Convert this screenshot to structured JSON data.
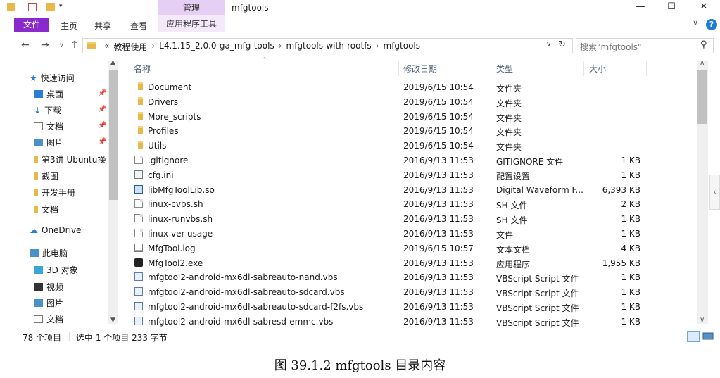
{
  "titlebar": {
    "manage_tab": "管理",
    "title": "mfgtools",
    "minimize": "—",
    "maximize": "☐",
    "close": "✕"
  },
  "ribbon": {
    "file": "文件",
    "home": "主页",
    "share": "共享",
    "view": "查看",
    "app_tools": "应用程序工具"
  },
  "address": {
    "prefix": "«",
    "crumbs": [
      "教程使用",
      "L4.1.15_2.0.0-ga_mfg-tools",
      "mfgtools-with-rootfs",
      "mfgtools"
    ],
    "search_placeholder": "搜索\"mfgtools\""
  },
  "sidebar": {
    "quick_access": "快速访问",
    "items": [
      {
        "label": "桌面",
        "icon": "desktop-icon",
        "pinned": true
      },
      {
        "label": "下载",
        "icon": "download-icon",
        "pinned": true
      },
      {
        "label": "文档",
        "icon": "documents-icon",
        "pinned": true
      },
      {
        "label": "图片",
        "icon": "pictures-icon",
        "pinned": true
      },
      {
        "label": "第3讲 Ubuntu操",
        "icon": "folder-icon",
        "pinned": false
      },
      {
        "label": "截图",
        "icon": "folder-icon",
        "pinned": false
      },
      {
        "label": "开发手册",
        "icon": "folder-icon",
        "pinned": false
      },
      {
        "label": "文档",
        "icon": "folder-icon",
        "pinned": false
      }
    ],
    "onedrive": "OneDrive",
    "this_pc": "此电脑",
    "pc_items": [
      {
        "label": "3D 对象",
        "icon": "3d-objects-icon"
      },
      {
        "label": "视频",
        "icon": "videos-icon"
      },
      {
        "label": "图片",
        "icon": "pictures-icon"
      },
      {
        "label": "文档",
        "icon": "documents-icon"
      }
    ]
  },
  "columns": {
    "name": "名称",
    "date": "修改日期",
    "type": "类型",
    "size": "大小"
  },
  "files": [
    {
      "name": "Document",
      "date": "2019/6/15 10:54",
      "type": "文件夹",
      "size": "",
      "icon": "folder"
    },
    {
      "name": "Drivers",
      "date": "2019/6/15 10:54",
      "type": "文件夹",
      "size": "",
      "icon": "folder"
    },
    {
      "name": "More_scripts",
      "date": "2019/6/15 10:54",
      "type": "文件夹",
      "size": "",
      "icon": "folder"
    },
    {
      "name": "Profiles",
      "date": "2019/6/15 10:54",
      "type": "文件夹",
      "size": "",
      "icon": "folder"
    },
    {
      "name": "Utils",
      "date": "2019/6/15 10:54",
      "type": "文件夹",
      "size": "",
      "icon": "folder"
    },
    {
      "name": ".gitignore",
      "date": "2016/9/13 11:53",
      "type": "GITIGNORE 文件",
      "size": "1 KB",
      "icon": "doc"
    },
    {
      "name": "cfg.ini",
      "date": "2016/9/13 11:53",
      "type": "配置设置",
      "size": "1 KB",
      "icon": "ini"
    },
    {
      "name": "libMfgToolLib.so",
      "date": "2016/9/13 11:53",
      "type": "Digital Waveform F...",
      "size": "6,393 KB",
      "icon": "lib"
    },
    {
      "name": "linux-cvbs.sh",
      "date": "2016/9/13 11:53",
      "type": "SH 文件",
      "size": "2 KB",
      "icon": "doc"
    },
    {
      "name": "linux-runvbs.sh",
      "date": "2016/9/13 11:53",
      "type": "SH 文件",
      "size": "1 KB",
      "icon": "doc"
    },
    {
      "name": "linux-ver-usage",
      "date": "2016/9/13 11:53",
      "type": "文件",
      "size": "1 KB",
      "icon": "doc"
    },
    {
      "name": "MfgTool.log",
      "date": "2019/6/15 10:57",
      "type": "文本文档",
      "size": "4 KB",
      "icon": "log"
    },
    {
      "name": "MfgTool2.exe",
      "date": "2016/9/13 11:53",
      "type": "应用程序",
      "size": "1,955 KB",
      "icon": "exe"
    },
    {
      "name": "mfgtool2-android-mx6dl-sabreauto-nand.vbs",
      "date": "2016/9/13 11:53",
      "type": "VBScript Script 文件",
      "size": "1 KB",
      "icon": "vbs"
    },
    {
      "name": "mfgtool2-android-mx6dl-sabreauto-sdcard.vbs",
      "date": "2016/9/13 11:53",
      "type": "VBScript Script 文件",
      "size": "1 KB",
      "icon": "vbs"
    },
    {
      "name": "mfgtool2-android-mx6dl-sabreauto-sdcard-f2fs.vbs",
      "date": "2016/9/13 11:53",
      "type": "VBScript Script 文件",
      "size": "1 KB",
      "icon": "vbs"
    },
    {
      "name": "mfgtool2-android-mx6dl-sabresd-emmc.vbs",
      "date": "2016/9/13 11:53",
      "type": "VBScript Script 文件",
      "size": "1 KB",
      "icon": "vbs"
    }
  ],
  "status": {
    "count": "78 个项目",
    "selection": "选中 1 个项目  233 字节"
  },
  "caption": "图 39.1.2 mfgtools 目录内容",
  "colors": {
    "file_tab": "#8a2acc",
    "manage_tab": "#e6cff4",
    "folder": "#e8b84a",
    "header_text": "#4c607a"
  }
}
